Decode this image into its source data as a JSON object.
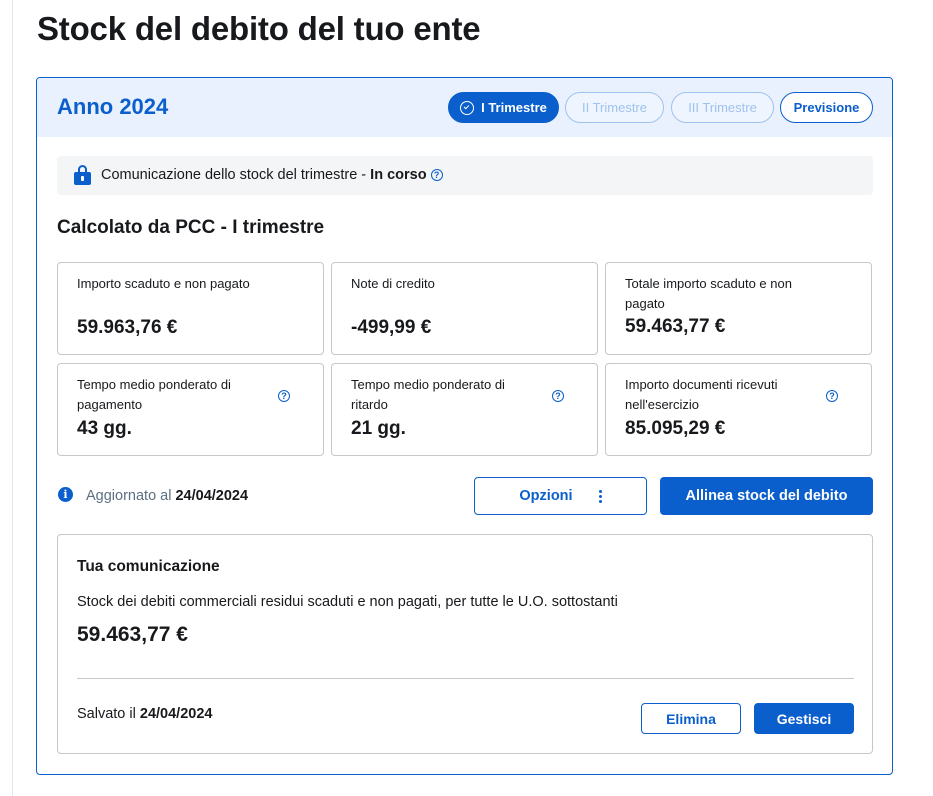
{
  "page": {
    "title": "Stock del debito del tuo ente"
  },
  "header": {
    "year_label": "Anno 2024",
    "tabs": [
      {
        "label": "I Trimestre",
        "state": "active"
      },
      {
        "label": "II Trimestre",
        "state": "disabled"
      },
      {
        "label": "III Trimestre",
        "state": "disabled"
      },
      {
        "label": "Previsione",
        "state": "enabled"
      }
    ]
  },
  "status": {
    "text": "Comunicazione dello stock del trimestre - ",
    "state": "In corso",
    "icon": "lock-icon"
  },
  "section": {
    "title": "Calcolato da PCC - I trimestre"
  },
  "metrics": [
    {
      "label": "Importo scaduto e non pagato",
      "value": "59.963,76 €",
      "help": false
    },
    {
      "label": "Note di credito",
      "value": "-499,99 €",
      "help": false
    },
    {
      "label": "Totale importo scaduto e non pagato",
      "value": "59.463,77 €",
      "help": false
    },
    {
      "label": "Tempo medio ponderato di pagamento",
      "value": "43 gg.",
      "help": true
    },
    {
      "label": "Tempo medio ponderato di ritardo",
      "value": "21 gg.",
      "help": true
    },
    {
      "label": "Importo documenti ricevuti nell'esercizio",
      "value": "85.095,29 €",
      "help": true
    }
  ],
  "updated": {
    "label": "Aggiornato al ",
    "date": "24/04/2024"
  },
  "actions": {
    "options_label": "Opzioni",
    "align_label": "Allinea stock del debito"
  },
  "communication": {
    "title": "Tua comunicazione",
    "description": "Stock dei debiti commerciali residui scaduti e non pagati, per tutte le U.O. sottostanti",
    "value": "59.463,77 €",
    "saved_label": "Salvato il ",
    "saved_date": "24/04/2024",
    "delete_label": "Elimina",
    "manage_label": "Gestisci"
  },
  "colors": {
    "primary": "#0b5fcc",
    "header_bg": "#e8f1fd",
    "muted_text": "#5c6f82",
    "border": "#c5c7c9"
  },
  "help_glyph": "?",
  "info_glyph": "i"
}
